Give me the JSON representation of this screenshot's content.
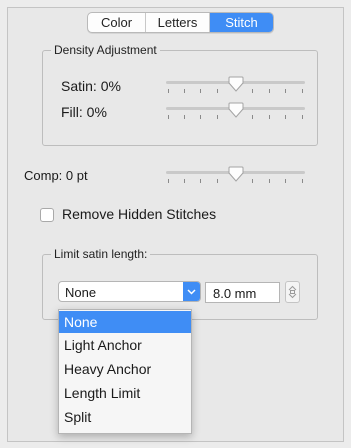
{
  "tabs": [
    {
      "label": "Color",
      "active": false
    },
    {
      "label": "Letters",
      "active": false
    },
    {
      "label": "Stitch",
      "active": true
    }
  ],
  "density": {
    "title": "Density Adjustment",
    "satin_label": "Satin: 0%",
    "fill_label": "Fill: 0%"
  },
  "comp_label": "Comp: 0 pt",
  "remove_hidden": {
    "label": "Remove Hidden Stitches",
    "checked": false
  },
  "limit_satin": {
    "title": "Limit satin length:",
    "selected": "None",
    "length_value": "8.0 mm"
  },
  "dropdown": {
    "options": [
      "None",
      "Light Anchor",
      "Heavy Anchor",
      "Length Limit",
      "Split"
    ],
    "highlighted_index": 0
  },
  "colors": {
    "accent": "#3f8df5"
  },
  "icons": {
    "popup_arrow": "chevron-down-icon",
    "stepper": "stepper-icon"
  }
}
